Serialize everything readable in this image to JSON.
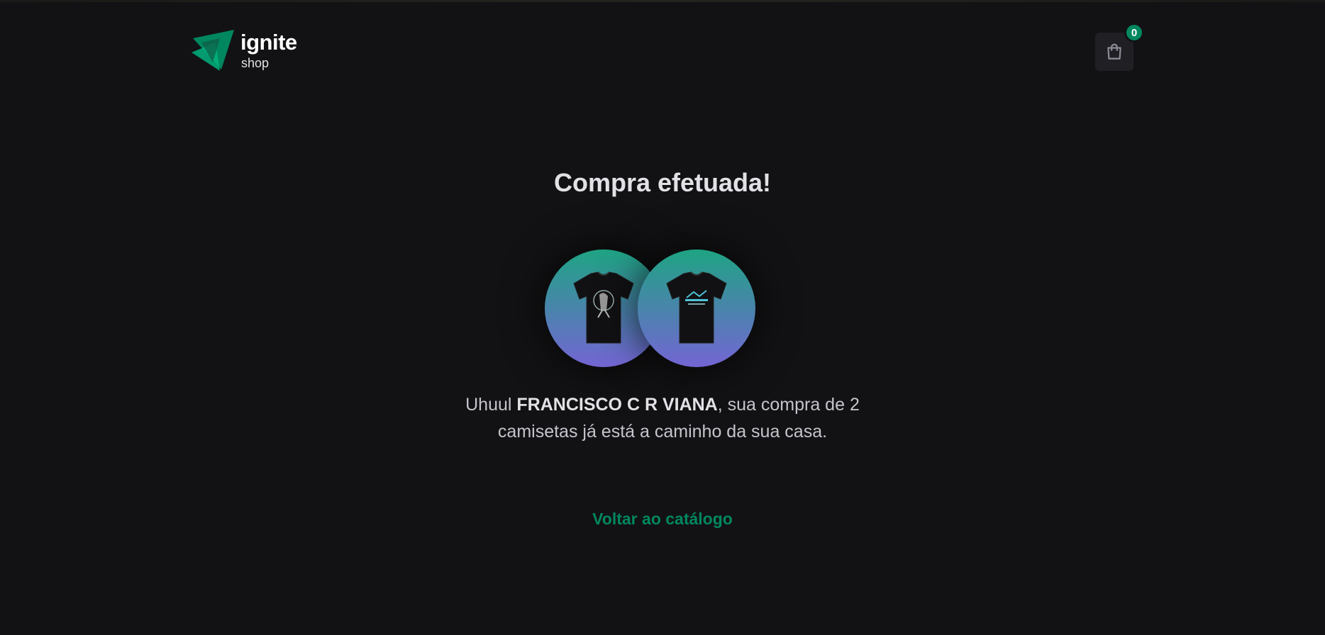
{
  "header": {
    "logo": {
      "title": "ignite",
      "subtitle": "shop",
      "icon": "triangle-logo-icon"
    },
    "cart": {
      "icon": "shopping-bag-icon",
      "count": "0"
    }
  },
  "main": {
    "title": "Compra efetuada!",
    "images": [
      {
        "icon": "tshirt-icon",
        "alt": "camiseta"
      },
      {
        "icon": "tshirt-icon",
        "alt": "camiseta"
      }
    ],
    "message": {
      "prefix": "Uhuul ",
      "customer_name": "FRANCISCO C R VIANA",
      "suffix": ", sua compra de 2 camisetas já está a caminho da sua casa."
    },
    "back_link": "Voltar ao catálogo"
  },
  "colors": {
    "background": "#121214",
    "accent": "#00875f",
    "gradient_top": "#1ea483",
    "gradient_bottom": "#7465d4"
  }
}
